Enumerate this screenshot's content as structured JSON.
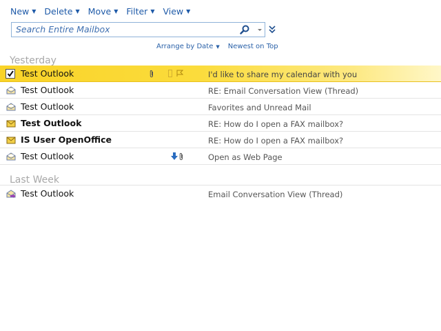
{
  "toolbar": {
    "items": [
      {
        "label": "New"
      },
      {
        "label": "Delete"
      },
      {
        "label": "Move"
      },
      {
        "label": "Filter"
      },
      {
        "label": "View"
      }
    ]
  },
  "search": {
    "placeholder": "Search Entire Mailbox"
  },
  "arrange": {
    "arrange_by": "Arrange by Date",
    "order": "Newest on Top"
  },
  "groups": [
    {
      "header": "Yesterday",
      "rows": [
        {
          "sender": "Test Outlook",
          "subject": "I'd like to share my calendar with you",
          "selected": true,
          "unread": false,
          "icon": "checkbox-icon"
        },
        {
          "sender": "Test Outlook",
          "subject": "RE: Email Conversation View (Thread)",
          "selected": false,
          "unread": false,
          "icon": "open-envelope-icon"
        },
        {
          "sender": "Test Outlook",
          "subject": "Favorites and Unread Mail",
          "selected": false,
          "unread": false,
          "icon": "open-envelope-icon"
        },
        {
          "sender": "Test Outlook",
          "subject": "RE: How do I open a FAX mailbox?",
          "selected": false,
          "unread": true,
          "icon": "closed-envelope-icon"
        },
        {
          "sender": "IS User OpenOffice",
          "subject": "RE: How do I open a FAX mailbox?",
          "selected": false,
          "unread": true,
          "icon": "closed-envelope-icon"
        },
        {
          "sender": "Test Outlook",
          "subject": "Open as Web Page",
          "selected": false,
          "unread": false,
          "icon": "open-envelope-icon"
        }
      ]
    },
    {
      "header": "Last Week",
      "rows": [
        {
          "sender": "Test Outlook",
          "subject": "Email Conversation View (Thread)",
          "selected": false,
          "unread": false,
          "icon": "forwarded-envelope-icon"
        }
      ]
    }
  ],
  "colors": {
    "link_blue": "#1e5aa8",
    "selection_yellow": "#f9d328",
    "group_header_gray": "#a8a8a8",
    "subject_gray": "#555555"
  }
}
